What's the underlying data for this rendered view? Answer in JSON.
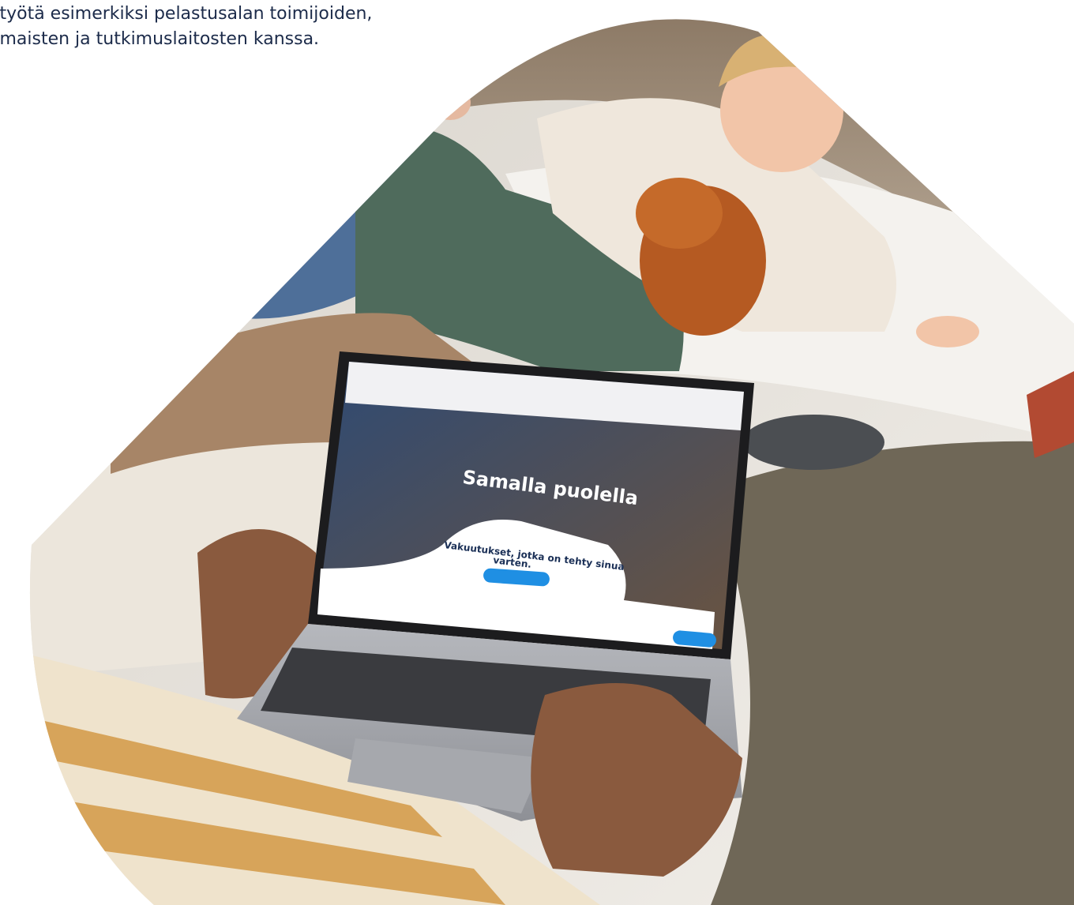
{
  "article": {
    "text_lines": [
      "styötä esimerkiksi pelastusalan toimijoiden,",
      "omaisten ja tutkimuslaitosten kanssa."
    ]
  },
  "laptop_screen": {
    "hero_title": "Samalla puolella",
    "hero_subtitle_line1": "Vakuutukset, jotka on tehty sinua",
    "hero_subtitle_line2": "varten."
  },
  "colors": {
    "text": "#1c2b4a",
    "brand_blue": "#1f8fe3",
    "screen_navy": "#1a2f56"
  }
}
